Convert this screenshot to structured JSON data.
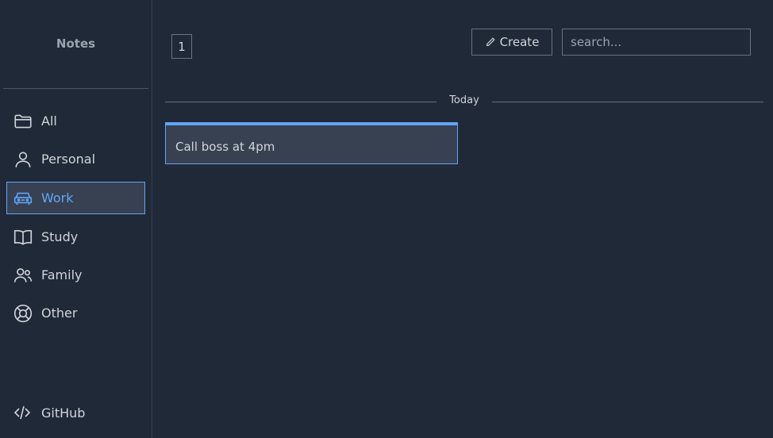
{
  "sidebar": {
    "title": "Notes",
    "items": [
      {
        "label": "All",
        "icon": "folder-icon"
      },
      {
        "label": "Personal",
        "icon": "user-icon"
      },
      {
        "label": "Work",
        "icon": "car-icon",
        "active": true
      },
      {
        "label": "Study",
        "icon": "book-icon"
      },
      {
        "label": "Family",
        "icon": "users-icon"
      },
      {
        "label": "Other",
        "icon": "lifebuoy-icon"
      }
    ],
    "footer_link": "GitHub"
  },
  "toolbar": {
    "page_number": "1",
    "create_label": "Create",
    "search_placeholder": "search..."
  },
  "notes": {
    "group_label": "Today",
    "items": [
      {
        "text": "Call boss at 4pm"
      }
    ]
  },
  "colors": {
    "background": "#1f2937",
    "accent": "#60a5fa",
    "card": "#374151"
  }
}
